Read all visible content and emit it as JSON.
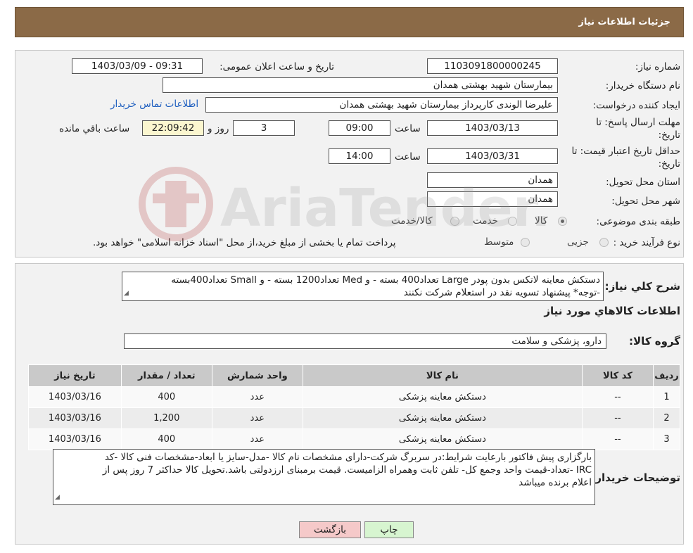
{
  "header": {
    "title": "جزئیات اطلاعات نیاز"
  },
  "details": {
    "need_number_label": "شماره نیاز:",
    "need_number": "1103091800000245",
    "announce_label": "تاریخ و ساعت اعلان عمومی:",
    "announce_value": "1403/03/09 - 09:31",
    "buyer_org_label": "نام دستگاه خریدار:",
    "buyer_org": "بیمارستان شهید بهشتی همدان",
    "creator_label": "ایجاد کننده درخواست:",
    "creator": "علیرضا الوندی کارپرداز بیمارستان شهید بهشتی همدان",
    "contact_link": "اطلاعات تماس خریدار",
    "deadline_label_1": "مهلت ارسال پاسخ: تا",
    "deadline_label_2": "تاریخ:",
    "deadline_date": "1403/03/13",
    "time_label": "ساعت",
    "deadline_time": "09:00",
    "days_value": "3",
    "days_label": "روز و",
    "remaining_time": "22:09:42",
    "remaining_label": "ساعت باقي مانده",
    "validity_label_1": "حداقل تاریخ اعتبار قیمت: تا",
    "validity_label_2": "تاریخ:",
    "validity_date": "1403/03/31",
    "validity_time": "14:00",
    "province_label": "استان محل تحویل:",
    "province": "همدان",
    "city_label": "شهر محل تحویل:",
    "city": "همدان",
    "category_label": "طبقه بندی موضوعی:",
    "category_options": [
      "کالا",
      "خدمت",
      "کالا/خدمت"
    ],
    "category_selected": "کالا",
    "process_label": "نوع فرآیند خرید :",
    "process_options": [
      "جزیی",
      "متوسط"
    ],
    "process_note": "پرداخت تمام یا بخشی از مبلغ خرید،از محل \"اسناد خزانه اسلامی\" خواهد بود."
  },
  "summary": {
    "desc_label": "شرح کلي نياز:",
    "desc_line1": "دستکش معاینه لاتکس بدون پودر Large تعداد400 بسته - و Med تعداد1200 بسته - و  Small تعداد400بسته",
    "desc_line2": "-توجه* پیشنهاد تسویه نقد در استعلام شرکت نکنند",
    "goods_info_title": "اطلاعات کالاهاي مورد نياز",
    "group_label": "گروه کالا:",
    "group_value": "دارو، پزشکی و سلامت",
    "table": {
      "headers": [
        "ردیف",
        "کد کالا",
        "نام کالا",
        "واحد شمارش",
        "تعداد / مقدار",
        "تاریخ نیاز"
      ],
      "rows": [
        [
          "1",
          "--",
          "دستکش معاینه پزشکی",
          "عدد",
          "400",
          "1403/03/16"
        ],
        [
          "2",
          "--",
          "دستکش معاینه پزشکی",
          "عدد",
          "1,200",
          "1403/03/16"
        ],
        [
          "3",
          "--",
          "دستکش معاینه پزشکی",
          "عدد",
          "400",
          "1403/03/16"
        ]
      ]
    },
    "buyer_notes_label": "توضیحات خریدار:",
    "buyer_notes_line1": "بارگزاری پیش فاکتور بارعایت شرایط:در سربرگ شرکت-دارای مشخصات نام کالا -مدل-سایز یا ابعاد-مشخصات فنی کالا -کد",
    "buyer_notes_line2": "IRC -تعداد-قیمت واحد وجمع کل- تلفن ثابت وهمراه الزامیست. قیمت برمبنای ارزدولتی باشد.تحویل کالا حداکثر 7 روز پس از",
    "buyer_notes_line3": "اعلام برنده میباشد"
  },
  "buttons": {
    "print": "چاپ",
    "back": "بازگشت"
  },
  "watermark": {
    "text": "AriaTender.neT"
  },
  "colors": {
    "header_bg": "#8b6a47",
    "link": "#1f5fbf",
    "back_btn": "#f5c9c9",
    "print_btn": "#d7f5d0"
  }
}
